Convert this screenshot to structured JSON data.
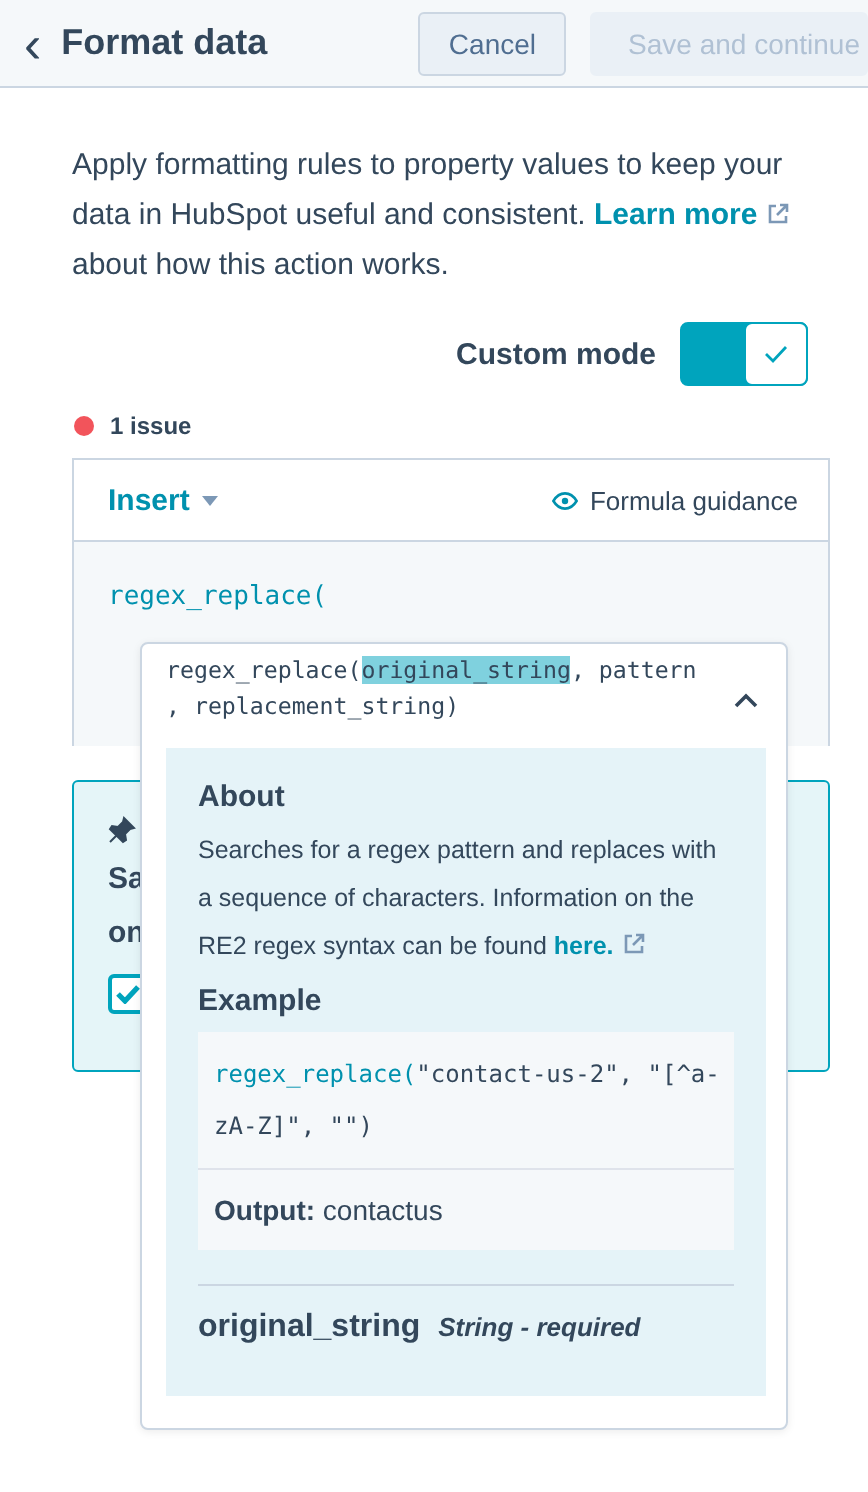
{
  "header": {
    "title": "Format data",
    "back": "‹",
    "buttons": [
      {
        "label": "Cancel",
        "disabled": false
      },
      {
        "label": "Save and continue",
        "disabled": true
      }
    ]
  },
  "intro": {
    "text_before": "Apply formatting rules to property values to keep your data in HubSpot useful and consistent. ",
    "link": "Learn more",
    "text_after": " about how this action works."
  },
  "custom_mode": {
    "label": "Custom mode",
    "on": true
  },
  "issues": {
    "label": "1 issue",
    "color": "#f2545b"
  },
  "editor": {
    "insert": "Insert",
    "guidance": "Formula guidance",
    "code": "regex_replace("
  },
  "behind_panel": {
    "lines": [
      "Sa",
      "on"
    ],
    "checked": true
  },
  "popup": {
    "signature": [
      [
        {
          "text": "regex_replace(",
          "highlighted": false
        },
        {
          "text": "original_string",
          "highlighted": true
        },
        {
          "text": ", pattern",
          "highlighted": false
        }
      ],
      [
        {
          "text": ", replacement_string)",
          "highlighted": false
        }
      ]
    ],
    "expanded": true,
    "about_title": "About",
    "about_text": "Searches for a regex pattern and replaces with a sequence of characters. Information on the RE2 regex syntax can be found ",
    "about_link": "here.",
    "example_title": "Example",
    "example_code": [
      [
        {
          "kind": "function",
          "text": "regex_replace("
        },
        {
          "kind": "plain",
          "text": "\"contact-us-2\", \"[^a-"
        }
      ],
      [
        {
          "kind": "plain",
          "text": "zA-Z]\", \"\")"
        }
      ]
    ],
    "output": "**Output:** contactus",
    "param_name": "original_string",
    "param_type": "String - required"
  }
}
